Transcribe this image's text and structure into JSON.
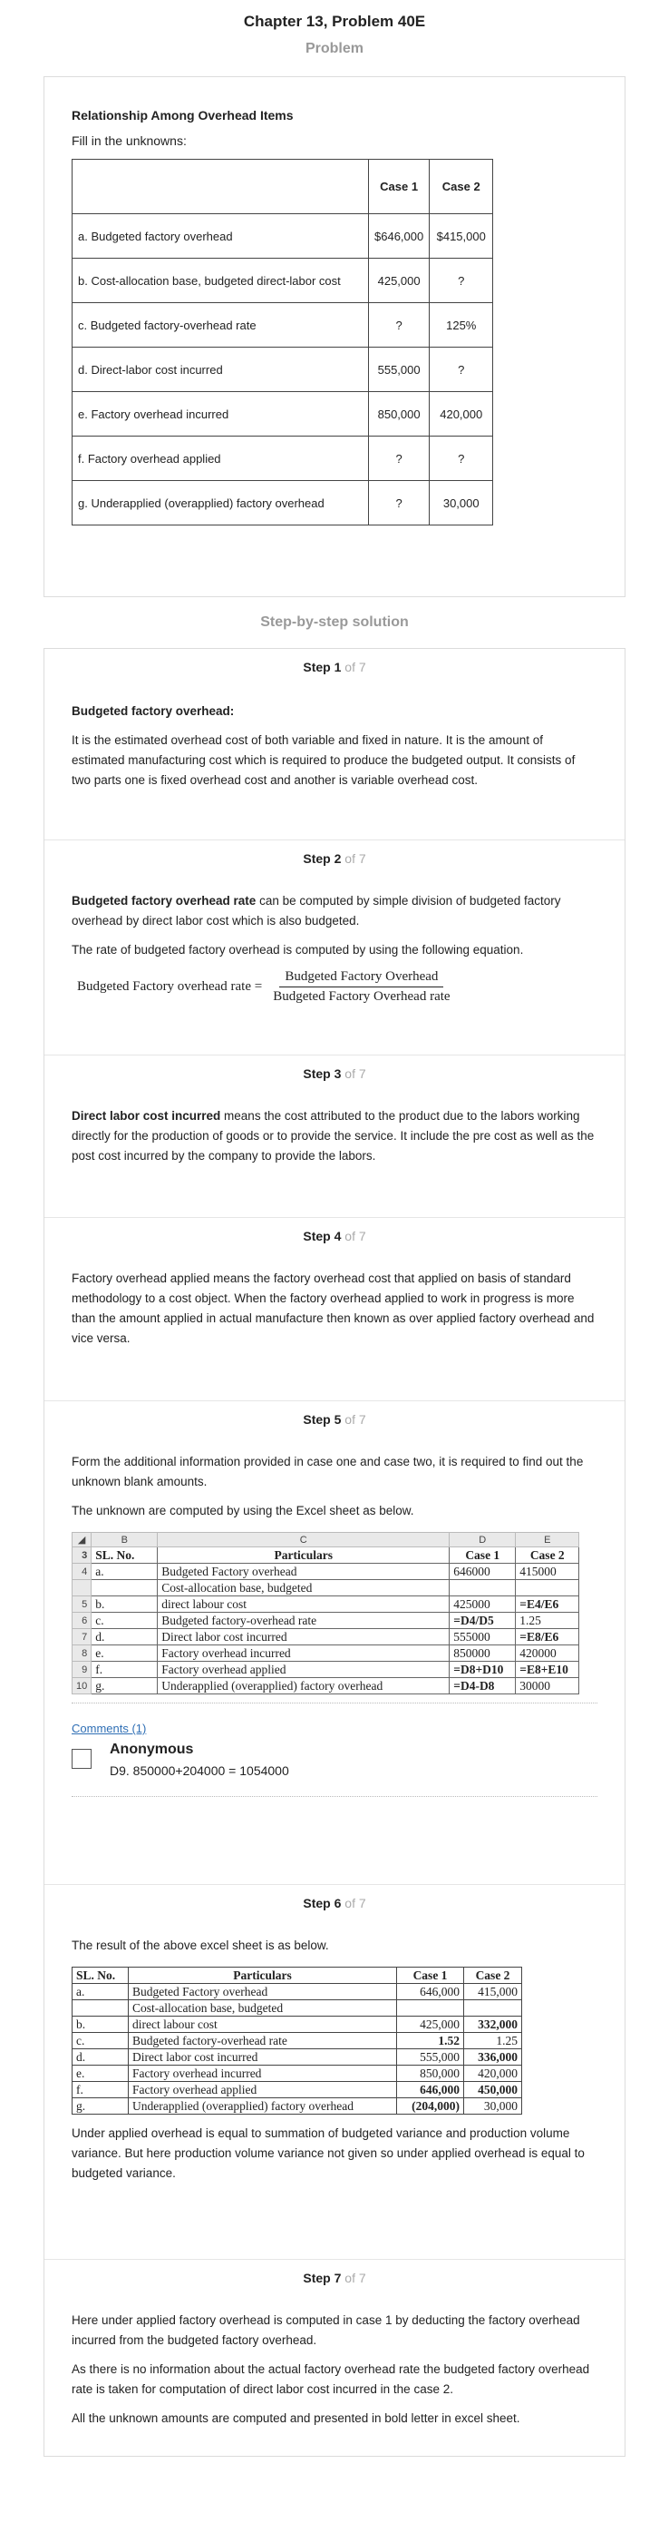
{
  "page_title": "Chapter 13, Problem 40E",
  "problem": {
    "section_label": "Problem",
    "heading": "Relationship Among Overhead Items",
    "subheading": "Fill in the unknowns:",
    "columns": [
      "",
      "Case 1",
      "Case 2"
    ],
    "rows": [
      {
        "label": "a. Budgeted factory overhead",
        "case1": "$646,000",
        "case2": "$415,000"
      },
      {
        "label": "b. Cost-allocation base, budgeted direct-labor cost",
        "case1": "425,000",
        "case2": "?"
      },
      {
        "label": "c. Budgeted factory-overhead rate",
        "case1": "?",
        "case2": "125%"
      },
      {
        "label": "d. Direct-labor cost incurred",
        "case1": "555,000",
        "case2": "?"
      },
      {
        "label": "e. Factory overhead incurred",
        "case1": "850,000",
        "case2": "420,000"
      },
      {
        "label": "f. Factory overhead applied",
        "case1": "?",
        "case2": "?"
      },
      {
        "label": "g. Underapplied (overapplied) factory overhead",
        "case1": "?",
        "case2": "30,000"
      }
    ]
  },
  "solution": {
    "section_label": "Step-by-step solution",
    "step_of": "of 7",
    "step_word": "Step",
    "step1": {
      "num": "1",
      "bold": "Budgeted factory overhead:",
      "text": "It is the estimated overhead cost of both variable and fixed in nature. It is the amount of estimated manufacturing cost which is required to produce the budgeted output. It consists of two parts one is fixed overhead cost and another is variable overhead cost."
    },
    "step2": {
      "num": "2",
      "bold": "Budgeted factory overhead rate",
      "text": " can be computed by simple division of budgeted factory overhead by direct labor cost which is also budgeted.",
      "text2": "The rate of budgeted factory overhead is computed by using the following equation.",
      "formula_lhs": "Budgeted Factory overhead rate =",
      "formula_num": "Budgeted Factory Overhead",
      "formula_den": "Budgeted Factory Overhead rate"
    },
    "step3": {
      "num": "3",
      "bold": "Direct labor cost incurred",
      "text": " means the cost attributed to the product due to the labors working directly for the production of goods or to provide the service. It include the pre cost as well as the post cost incurred by the company to provide the labors."
    },
    "step4": {
      "num": "4",
      "text": "Factory overhead applied means the factory overhead cost that applied on basis of standard methodology to a cost object. When the factory overhead applied to work in progress is more than the amount applied in actual manufacture then known as over applied factory overhead and vice versa."
    },
    "step5": {
      "num": "5",
      "text": "Form the additional information provided in case one and case two, it is required to find out the unknown blank amounts.",
      "text2": "The unknown are computed by using the Excel sheet as below.",
      "excel": {
        "col_headers": [
          "B",
          "C",
          "D",
          "E"
        ],
        "header_row": {
          "rn": "3",
          "b": "SL. No.",
          "c": "Particulars",
          "d": "Case 1",
          "e": "Case 2"
        },
        "rows": [
          {
            "rn": "4",
            "b": "a.",
            "c": "Budgeted Factory overhead",
            "d": "646000",
            "e": "415000"
          },
          {
            "rn": "",
            "b": "",
            "c": "Cost-allocation base, budgeted",
            "d": "",
            "e": ""
          },
          {
            "rn": "5",
            "b": "b.",
            "c": "direct labour cost",
            "d": "425000",
            "e": "=E4/E6"
          },
          {
            "rn": "6",
            "b": "c.",
            "c": "Budgeted factory-overhead rate",
            "d": "=D4/D5",
            "e": "1.25"
          },
          {
            "rn": "7",
            "b": "d.",
            "c": "Direct labor cost incurred",
            "d": "555000",
            "e": "=E8/E6"
          },
          {
            "rn": "8",
            "b": "e.",
            "c": "Factory overhead incurred",
            "d": "850000",
            "e": "420000"
          },
          {
            "rn": "9",
            "b": "f.",
            "c": "Factory overhead applied",
            "d": "=D8+D10",
            "e": "=E8+E10"
          },
          {
            "rn": "10",
            "b": "g.",
            "c": "Underapplied (overapplied) factory overhead",
            "d": "=D4-D8",
            "e": "30000"
          }
        ]
      },
      "comments_link": "Comments (1)",
      "comment_author": "Anonymous",
      "comment_text": "D9. 850000+204000 = 1054000"
    },
    "step6": {
      "num": "6",
      "text": "The result of the above excel sheet is as below.",
      "table": {
        "header": {
          "a": "SL. No.",
          "b": "Particulars",
          "c": "Case 1",
          "d": "Case 2"
        },
        "rows": [
          {
            "a": "a.",
            "b": "Budgeted Factory overhead",
            "c": "646,000",
            "d": "415,000"
          },
          {
            "a": "",
            "b": "Cost-allocation base, budgeted",
            "c": "",
            "d": ""
          },
          {
            "a": "b.",
            "b": "direct labour cost",
            "c": "425,000",
            "d": "332,000"
          },
          {
            "a": "c.",
            "b": "Budgeted factory-overhead rate",
            "c": "1.52",
            "d": "1.25"
          },
          {
            "a": "d.",
            "b": "Direct labor cost incurred",
            "c": "555,000",
            "d": "336,000"
          },
          {
            "a": "e.",
            "b": "Factory overhead incurred",
            "c": "850,000",
            "d": "420,000"
          },
          {
            "a": "f.",
            "b": "Factory overhead applied",
            "c": "646,000",
            "d": "450,000"
          },
          {
            "a": "g.",
            "b": "Underapplied (overapplied) factory overhead",
            "c": "(204,000)",
            "d": "30,000"
          }
        ]
      },
      "text2": "Under applied overhead is equal to summation of budgeted variance and production volume variance. But here production volume variance not given so under applied overhead is equal to budgeted variance."
    },
    "step7": {
      "num": "7",
      "text": "Here under applied factory overhead is computed in case 1 by deducting the factory overhead incurred from the budgeted factory overhead.",
      "text2": "As there is no information about the actual factory overhead rate the budgeted factory overhead rate is taken for computation of direct labor cost incurred in the case 2.",
      "text3": "All the unknown amounts are computed and presented in bold letter in excel sheet."
    }
  }
}
